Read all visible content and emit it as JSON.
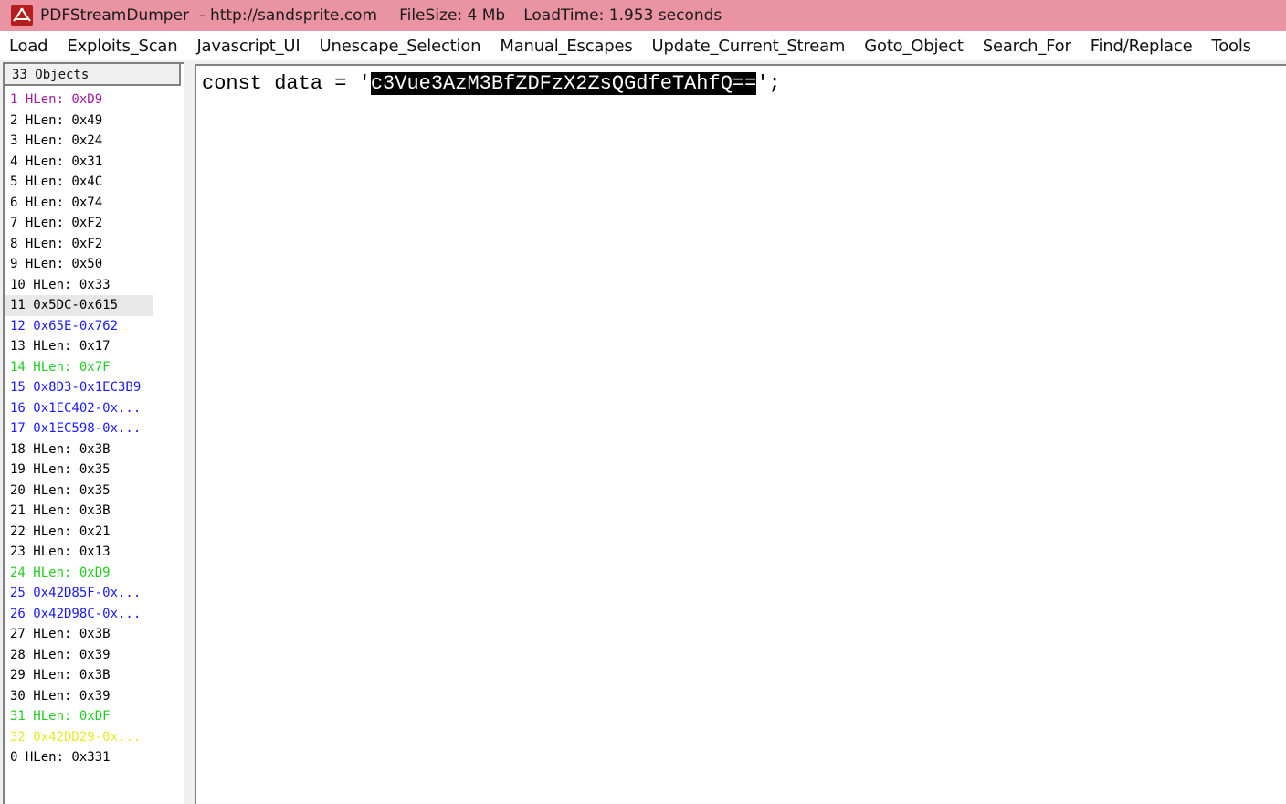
{
  "titlebar": {
    "app_name": "PDFStreamDumper",
    "url": " - http://sandsprite.com",
    "file_size": "FileSize: 4 Mb",
    "load_time": "LoadTime: 1.953 seconds",
    "icon": "pdf-icon",
    "background_color": "#e993a3"
  },
  "menu": [
    "Load",
    "Exploits_Scan",
    "Javascript_UI",
    "Unescape_Selection",
    "Manual_Escapes",
    "Update_Current_Stream",
    "Goto_Object",
    "Search_For",
    "Find/Replace",
    "Tools"
  ],
  "objects_panel": {
    "header": "33 Objects",
    "selected_index": 10,
    "items": [
      {
        "text": "1 HLen: 0xD9",
        "color": "#a020a0"
      },
      {
        "text": "2 HLen: 0x49",
        "color": "#000000"
      },
      {
        "text": "3 HLen: 0x24",
        "color": "#000000"
      },
      {
        "text": "4 HLen: 0x31",
        "color": "#000000"
      },
      {
        "text": "5 HLen: 0x4C",
        "color": "#000000"
      },
      {
        "text": "6 HLen: 0x74",
        "color": "#000000"
      },
      {
        "text": "7 HLen: 0xF2",
        "color": "#000000"
      },
      {
        "text": "8 HLen: 0xF2",
        "color": "#000000"
      },
      {
        "text": "9 HLen: 0x50",
        "color": "#000000"
      },
      {
        "text": "10 HLen: 0x33",
        "color": "#000000"
      },
      {
        "text": "11 0x5DC-0x615",
        "color": "#000000"
      },
      {
        "text": "12 0x65E-0x762",
        "color": "#1a1aff"
      },
      {
        "text": "13 HLen: 0x17",
        "color": "#000000"
      },
      {
        "text": "14 HLen: 0x7F",
        "color": "#22cc22"
      },
      {
        "text": "15 0x8D3-0x1EC3B9",
        "color": "#1a1aff"
      },
      {
        "text": "16 0x1EC402-0x...",
        "color": "#1a1aff"
      },
      {
        "text": "17 0x1EC598-0x...",
        "color": "#1a1aff"
      },
      {
        "text": "18 HLen: 0x3B",
        "color": "#000000"
      },
      {
        "text": "19 HLen: 0x35",
        "color": "#000000"
      },
      {
        "text": "20 HLen: 0x35",
        "color": "#000000"
      },
      {
        "text": "21 HLen: 0x3B",
        "color": "#000000"
      },
      {
        "text": "22 HLen: 0x21",
        "color": "#000000"
      },
      {
        "text": "23 HLen: 0x13",
        "color": "#000000"
      },
      {
        "text": "24 HLen: 0xD9",
        "color": "#22cc22"
      },
      {
        "text": "25 0x42D85F-0x...",
        "color": "#1a1aff"
      },
      {
        "text": "26 0x42D98C-0x...",
        "color": "#1a1aff"
      },
      {
        "text": "27 HLen: 0x3B",
        "color": "#000000"
      },
      {
        "text": "28 HLen: 0x39",
        "color": "#000000"
      },
      {
        "text": "29 HLen: 0x3B",
        "color": "#000000"
      },
      {
        "text": "30 HLen: 0x39",
        "color": "#000000"
      },
      {
        "text": "31 HLen: 0xDF",
        "color": "#22cc22"
      },
      {
        "text": "32 0x42DD29-0x...",
        "color": "#e8e830"
      },
      {
        "text": "0 HLen: 0x331",
        "color": "#000000"
      }
    ]
  },
  "editor": {
    "code_prefix": "const data = '",
    "selected_text": "c3Vue3AzM3BfZDFzX2ZsQGdfeTAhfQ==",
    "code_suffix": "';"
  }
}
